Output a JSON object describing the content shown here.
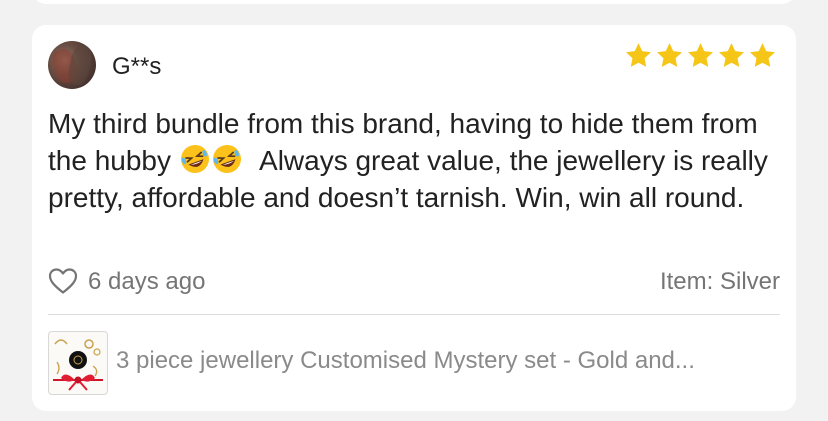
{
  "review": {
    "username": "G**s",
    "rating": 5,
    "rating_max": 5,
    "text_before_emoji": "My third bundle from this brand, having to hide them from the hubby ",
    "emoji": [
      "rolling-on-floor-laughing",
      "rolling-on-floor-laughing"
    ],
    "text_after_emoji": " Always great value, the jewellery is really pretty, affordable and doesn’t tarnish. Win, win all round.",
    "date": "6 days ago",
    "item_variant": "Item: Silver"
  },
  "product": {
    "title": "3 piece jewellery Customised Mystery set - Gold and..."
  },
  "colors": {
    "star": "#f5c518",
    "background": "#f2f2f2",
    "card": "#ffffff",
    "meta_text": "#757575"
  }
}
